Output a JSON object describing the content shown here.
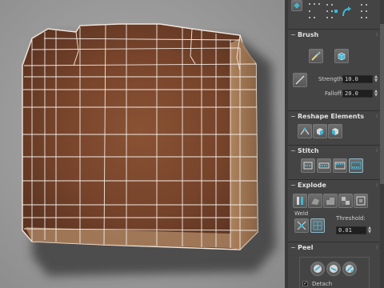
{
  "viewport": {
    "name": "UV Editor viewport"
  },
  "panel": {
    "brush": {
      "title": "Brush",
      "strength_label": "Strength:",
      "strength_value": "10.0",
      "falloff_label": "Falloff:",
      "falloff_value": "20.0"
    },
    "reshape": {
      "title": "Reshape Elements"
    },
    "stitch": {
      "title": "Stitch"
    },
    "explode": {
      "title": "Explode",
      "weld_label": "Weld",
      "threshold_label": "Threshold:",
      "threshold_value": "0.01"
    },
    "peel": {
      "title": "Peel",
      "detach_label": "Detach"
    },
    "collapse_sign": "−",
    "accent_color": "#3fb6d4"
  }
}
